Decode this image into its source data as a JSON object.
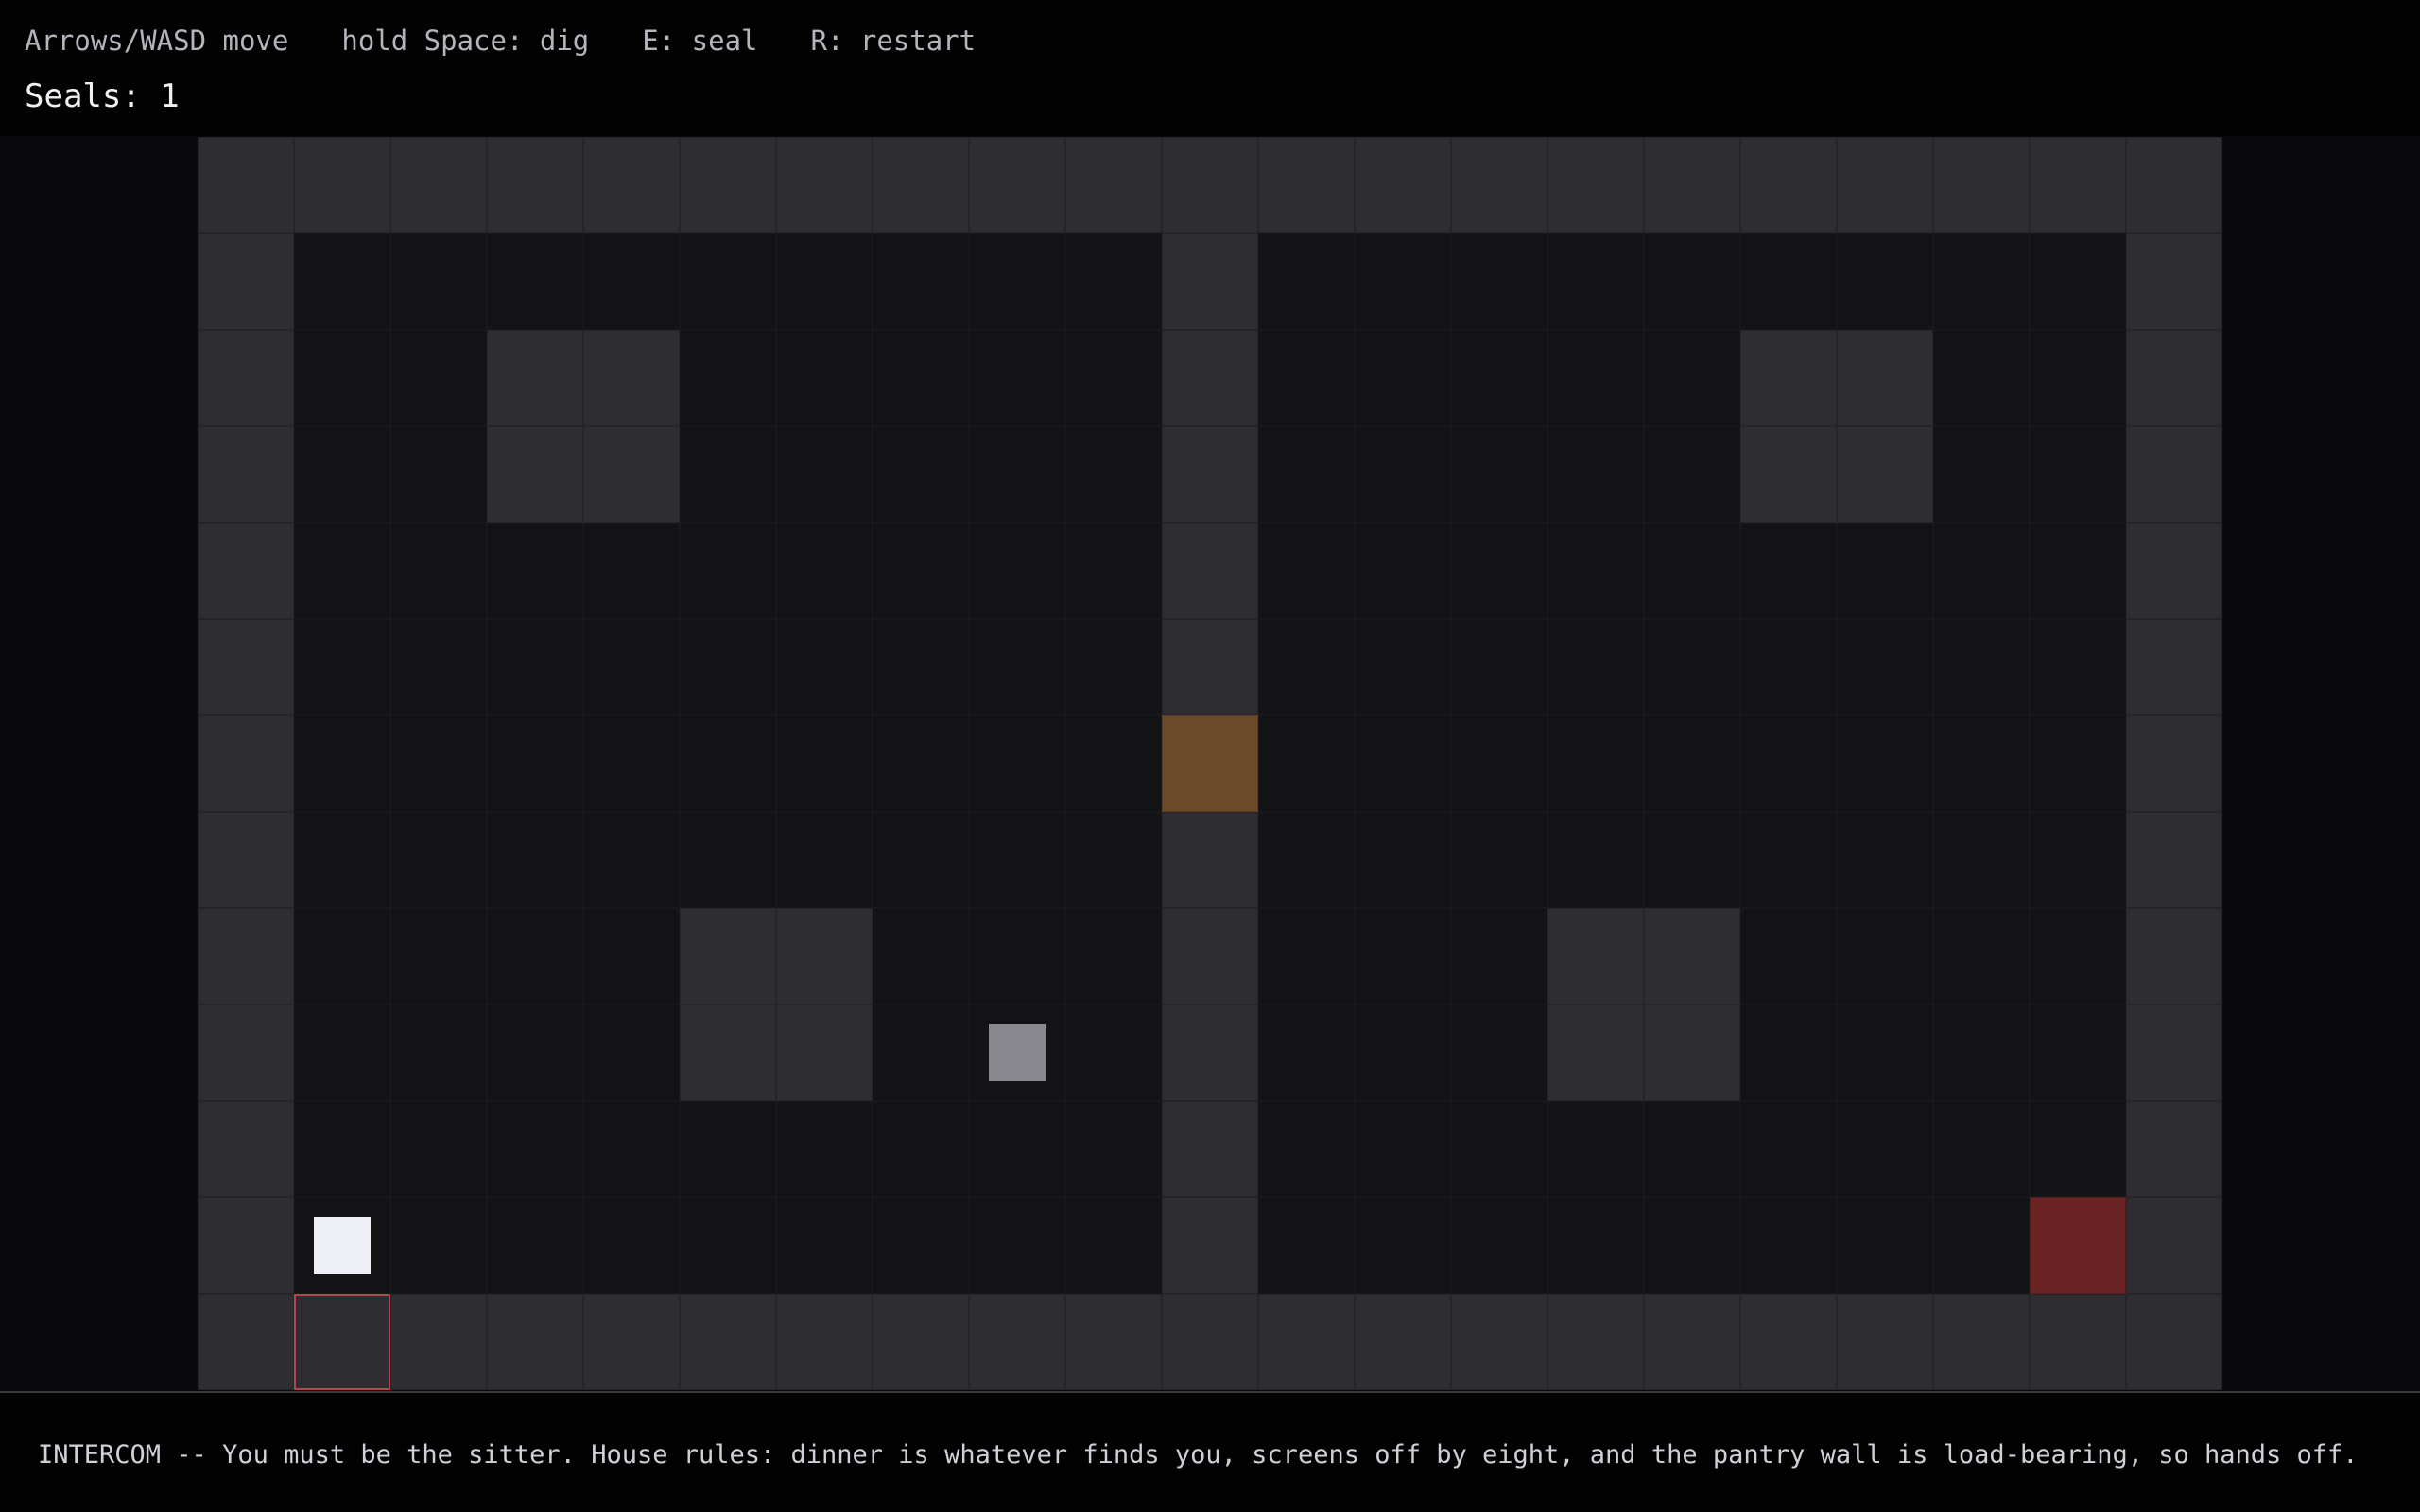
{
  "hud": {
    "controls": [
      "Arrows/WASD move",
      "hold Space: dig",
      "E: seal",
      "R: restart"
    ],
    "seals_text": "Seals: 1"
  },
  "message": {
    "intercom_text": "INTERCOM -- You must be the sitter. House rules: dinner is whatever finds you, screens off by eight, and the pantry wall is load-bearing, so hands off."
  },
  "map": {
    "legend": {
      "#": "wall",
      ".": "floor",
      "D": "door",
      "X": "hazard",
      "E": "exit"
    },
    "rows": [
      "#####################",
      "#.........#.........#",
      "#..##.....#.....##..#",
      "#..##.....#.....##..#",
      "#.........#.........#",
      "#.........#.........#",
      "#.........D.........#",
      "#.........#.........#",
      "#....##...#...##....#",
      "#....##...#...##....#",
      "#.........#.........#",
      "#.........#........X#",
      "#E###################"
    ],
    "player": {
      "col": 1,
      "row": 11
    },
    "crate": {
      "col": 8,
      "row": 9
    }
  },
  "colors": {
    "wall": "#2d2d32",
    "floor": "#131316",
    "door": "#6a4a28",
    "hazard": "#6a2424",
    "exit_outline": "#b34848",
    "player": "#eeeef6",
    "crate": "#88888e"
  }
}
